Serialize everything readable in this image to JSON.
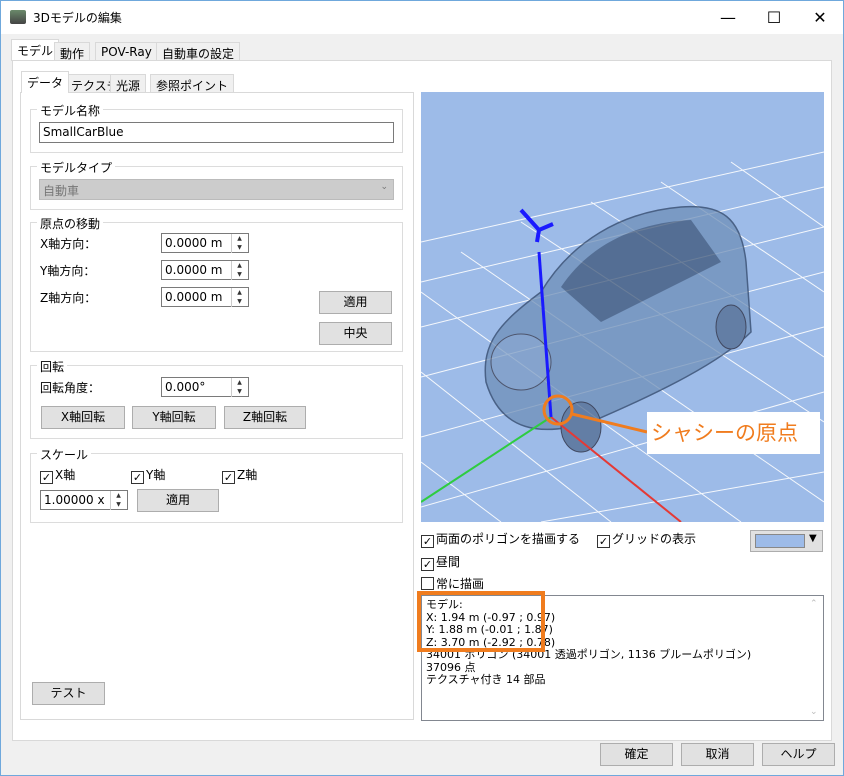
{
  "window": {
    "title": "3Dモデルの編集",
    "min": "—",
    "max": "☐",
    "close": "✕"
  },
  "tabs": [
    "モデル",
    "動作",
    "POV-Ray",
    "自動車の設定"
  ],
  "subtabs": [
    "データ",
    "テクスチャ",
    "光源",
    "参照ポイント"
  ],
  "model_name": {
    "label": "モデル名称",
    "value": "SmallCarBlue"
  },
  "model_type": {
    "label": "モデルタイプ",
    "value": "自動車"
  },
  "origin": {
    "label": "原点の移動",
    "x_label": "X軸方向：",
    "y_label": "Y軸方向：",
    "z_label": "Z軸方向：",
    "x": "0.0000 m",
    "y": "0.0000 m",
    "z": "0.0000 m",
    "apply": "適用",
    "center": "中央"
  },
  "rotation": {
    "label": "回転",
    "angle_label": "回転角度：",
    "angle": "0.000°",
    "x_btn": "X軸回転",
    "y_btn": "Y軸回転",
    "z_btn": "Z軸回転"
  },
  "scale": {
    "label": "スケール",
    "x": "X軸",
    "y": "Y軸",
    "z": "Z軸",
    "value": "1.00000 x",
    "apply": "適用"
  },
  "test_button": "テスト",
  "viewport": {
    "callout": "シャシーの原点",
    "bg_color": "#9dbbe8"
  },
  "options": {
    "double_sided": "両面のポリゴンを描画する",
    "grid": "グリッドの表示",
    "daytime": "昼間",
    "always_draw": "常に描画"
  },
  "info": [
    "モデル:",
    "X: 1.94 m (-0.97 ; 0.97)",
    "Y: 1.88 m (-0.01 ; 1.87)",
    "Z: 3.70 m (-2.92 ; 0.78)",
    "34001 ポリゴン (34001 透過ポリゴン, 1136 ブルームポリゴン)",
    "37096 点",
    "テクスチャ付き 14 部品"
  ],
  "footer": {
    "ok": "確定",
    "cancel": "取消",
    "help": "ヘルプ"
  }
}
